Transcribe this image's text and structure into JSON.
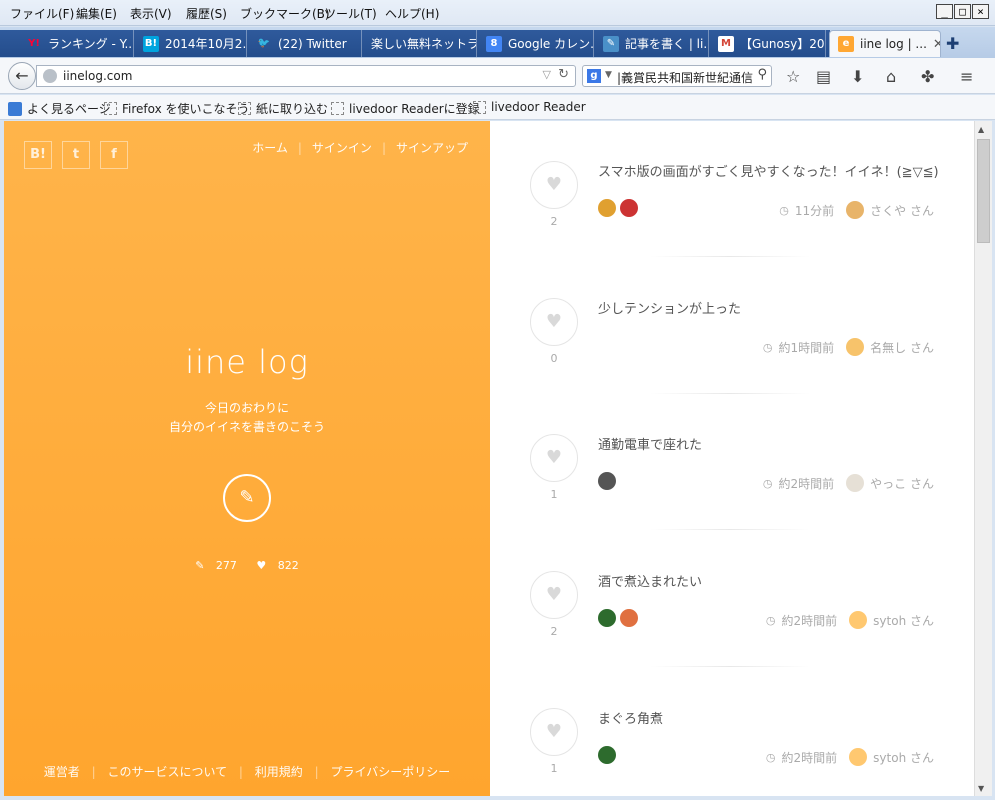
{
  "menu": [
    "ファイル(F)",
    "編集(E)",
    "表示(V)",
    "履歴(S)",
    "ブックマーク(B)",
    "ツール(T)",
    "ヘルプ(H)"
  ],
  "window_controls": [
    "_",
    "□",
    "×"
  ],
  "tabs": [
    {
      "label": "ランキング - Y...",
      "icon": "Y!",
      "color": "#ff0033"
    },
    {
      "label": "2014年10月2...",
      "icon": "B!",
      "color": "#00a4de"
    },
    {
      "label": "(22) Twitter",
      "icon": "🐦",
      "color": "#55acee"
    },
    {
      "label": "楽しい無料ネットラ...",
      "icon": "",
      "color": "#2f5a9c"
    },
    {
      "label": "Google カレン...",
      "icon": "8",
      "color": "#4285f4"
    },
    {
      "label": "記事を書く | li...",
      "icon": "✎",
      "color": "#4a90c8"
    },
    {
      "label": "【Gunosy】201...",
      "icon": "M",
      "color": "#d44638"
    },
    {
      "label": "iine log | ...",
      "icon": "e",
      "color": "#ffa733"
    }
  ],
  "nav": {
    "back_icon": "←",
    "url": "iinelog.com",
    "search_query": "|義賞民共和国新世紀通信"
  },
  "bookmarks": [
    "よく見るページ",
    "Firefox を使いこなそう",
    "紙に取り込む",
    "livedoor Readerに登録",
    "livedoor Reader"
  ],
  "hero": {
    "share_buttons": [
      "B!",
      "t",
      "f"
    ],
    "nav_links": [
      "ホーム",
      "サインイン",
      "サインアップ"
    ],
    "logo": "iine log",
    "tagline_1": "今日のおわりに",
    "tagline_2": "自分のイイネを書きのこそう",
    "post_count": "277",
    "like_count": "822",
    "footer_links": [
      "運営者",
      "このサービスについて",
      "利用規約",
      "プライバシーポリシー"
    ]
  },
  "posts": [
    {
      "text": "スマホ版の画面がすごく見やすくなった！イイネ！(≧▽≦)",
      "likes": "2",
      "time": "11分前",
      "author": "さくや さん",
      "avatar_color": "#e8b46a",
      "likers": [
        "#e0a030",
        "#cc3333"
      ]
    },
    {
      "text": "少しテンションが上った",
      "likes": "0",
      "time": "約1時間前",
      "author": "名無し さん",
      "avatar_color": "#f7c36b",
      "likers": []
    },
    {
      "text": "通勤電車で座れた",
      "likes": "1",
      "time": "約2時間前",
      "author": "やっこ さん",
      "avatar_color": "#e6e0d6",
      "likers": [
        "#555555"
      ]
    },
    {
      "text": "酒で煮込まれたい",
      "likes": "2",
      "time": "約2時間前",
      "author": "sytoh さん",
      "avatar_color": "#ffc870",
      "likers": [
        "#2d6b2d",
        "#e07040"
      ]
    },
    {
      "text": "まぐろ角煮",
      "likes": "1",
      "time": "約2時間前",
      "author": "sytoh さん",
      "avatar_color": "#ffc870",
      "likers": [
        "#2d6b2d"
      ]
    }
  ]
}
